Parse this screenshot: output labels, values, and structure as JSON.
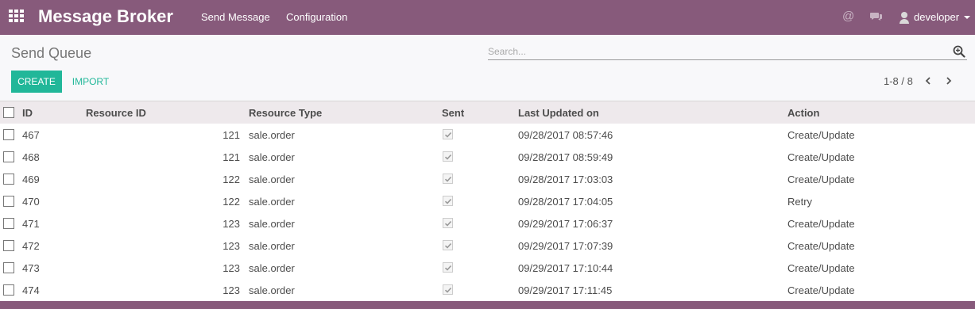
{
  "app": {
    "title": "Message Broker"
  },
  "menu": [
    {
      "label": "Send Message"
    },
    {
      "label": "Configuration"
    }
  ],
  "systray": {
    "at_symbol": "@",
    "user_name": "developer"
  },
  "breadcrumb": "Send Queue",
  "search": {
    "placeholder": "Search...",
    "value": ""
  },
  "buttons": {
    "create": "CREATE",
    "import": "IMPORT"
  },
  "pager": {
    "value": "1-8 / 8"
  },
  "table": {
    "headers": {
      "id": "ID",
      "resource_id": "Resource ID",
      "resource_type": "Resource Type",
      "sent": "Sent",
      "last_updated": "Last Updated on",
      "action": "Action"
    },
    "rows": [
      {
        "id": "467",
        "resource_id": "121",
        "resource_type": "sale.order",
        "sent": true,
        "last_updated": "09/28/2017 08:57:46",
        "action": "Create/Update"
      },
      {
        "id": "468",
        "resource_id": "121",
        "resource_type": "sale.order",
        "sent": true,
        "last_updated": "09/28/2017 08:59:49",
        "action": "Create/Update"
      },
      {
        "id": "469",
        "resource_id": "122",
        "resource_type": "sale.order",
        "sent": true,
        "last_updated": "09/28/2017 17:03:03",
        "action": "Create/Update"
      },
      {
        "id": "470",
        "resource_id": "122",
        "resource_type": "sale.order",
        "sent": true,
        "last_updated": "09/28/2017 17:04:05",
        "action": "Retry"
      },
      {
        "id": "471",
        "resource_id": "123",
        "resource_type": "sale.order",
        "sent": true,
        "last_updated": "09/29/2017 17:06:37",
        "action": "Create/Update"
      },
      {
        "id": "472",
        "resource_id": "123",
        "resource_type": "sale.order",
        "sent": true,
        "last_updated": "09/29/2017 17:07:39",
        "action": "Create/Update"
      },
      {
        "id": "473",
        "resource_id": "123",
        "resource_type": "sale.order",
        "sent": true,
        "last_updated": "09/29/2017 17:10:44",
        "action": "Create/Update"
      },
      {
        "id": "474",
        "resource_id": "123",
        "resource_type": "sale.order",
        "sent": true,
        "last_updated": "09/29/2017 17:11:45",
        "action": "Create/Update"
      }
    ]
  },
  "icons": {
    "apps": "apps-grid-icon",
    "at": "at-icon",
    "chat": "chat-icon",
    "avatar": "user-avatar-icon",
    "caret": "caret-down-icon",
    "search": "search-zoom-icon",
    "prev": "chevron-left-icon",
    "next": "chevron-right-icon",
    "check": "check-icon"
  },
  "colors": {
    "brand": "#875a7b",
    "accent": "#21b799",
    "header_row": "#eee9ec",
    "panel": "#f8f8fa"
  }
}
